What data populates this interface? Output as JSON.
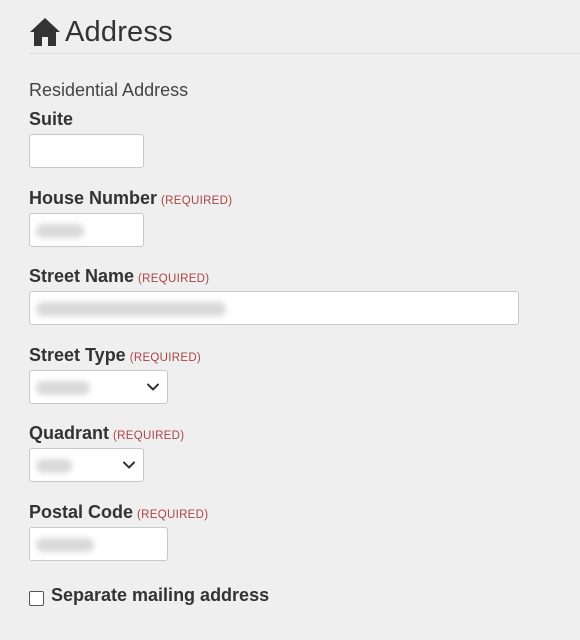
{
  "page": {
    "title": "Address",
    "section_label": "Residential Address",
    "required_tag": "(REQUIRED)"
  },
  "fields": {
    "suite": {
      "label": "Suite",
      "value": ""
    },
    "house_number": {
      "label": "House Number",
      "required": true
    },
    "street_name": {
      "label": "Street Name",
      "required": true
    },
    "street_type": {
      "label": "Street Type",
      "required": true
    },
    "quadrant": {
      "label": "Quadrant",
      "required": true
    },
    "postal_code": {
      "label": "Postal Code",
      "required": true
    }
  },
  "mailing": {
    "checkbox_label": "Separate mailing address",
    "checked": false
  },
  "icons": {
    "header": "home-icon",
    "select_arrow": "chevron-down-icon"
  },
  "colors": {
    "background": "#efefef",
    "required": "#a94442",
    "text": "#333333",
    "input_border": "#c8c8c8"
  }
}
